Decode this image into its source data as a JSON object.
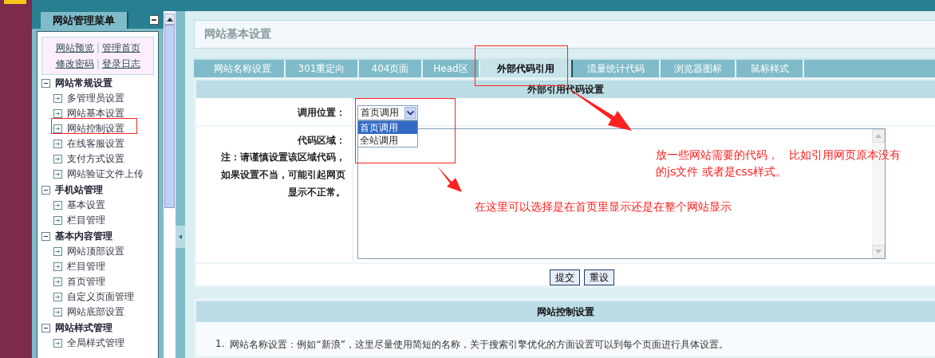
{
  "sidebar": {
    "title": "网站管理菜单",
    "quick_links": [
      "网站预览",
      "管理首页",
      "修改密码",
      "登录日志"
    ],
    "groups": [
      {
        "label": "网站常规设置",
        "expanded": true,
        "children": [
          {
            "label": "多管理员设置"
          },
          {
            "label": "网站基本设置"
          },
          {
            "label": "网站控制设置"
          },
          {
            "label": "在线客服设置"
          },
          {
            "label": "支付方式设置"
          },
          {
            "label": "网站验证文件上传"
          }
        ]
      },
      {
        "label": "手机站管理",
        "expanded": true,
        "children": [
          {
            "label": "基本设置"
          },
          {
            "label": "栏目管理"
          }
        ]
      },
      {
        "label": "基本内容管理",
        "expanded": true,
        "children": [
          {
            "label": "网站顶部设置"
          },
          {
            "label": "栏目管理"
          },
          {
            "label": "首页管理"
          },
          {
            "label": "自定义页面管理"
          },
          {
            "label": "网站底部设置"
          }
        ]
      },
      {
        "label": "网站样式管理",
        "expanded": true,
        "children": [
          {
            "label": "全局样式管理"
          }
        ]
      }
    ]
  },
  "page_title": "网站基本设置",
  "tabs": [
    {
      "label": "网站名称设置",
      "selected": false
    },
    {
      "label": "301重定向",
      "selected": false
    },
    {
      "label": "404页面",
      "selected": false
    },
    {
      "label": "Head区",
      "selected": false
    },
    {
      "label": "外部代码引用",
      "selected": true
    },
    {
      "label": "流量统计代码",
      "selected": false
    },
    {
      "label": "浏览器图标",
      "selected": false
    },
    {
      "label": "鼠标样式",
      "selected": false
    }
  ],
  "form": {
    "title": "外部引用代码设置",
    "fields": [
      {
        "kind": "select",
        "label": "调用位置：",
        "value": "首页调用",
        "expanded": true,
        "options": [
          {
            "label": "首页调用",
            "selected": true
          },
          {
            "label": "全站调用",
            "selected": false
          }
        ]
      },
      {
        "kind": "textarea",
        "label": "代码区域：",
        "note": "注：请谨慎设置该区域代码，如果设置不当，可能引起网页显示不正常。"
      }
    ],
    "buttons": [
      "提交",
      "重设"
    ]
  },
  "help": {
    "title": "网站控制设置",
    "items": [
      {
        "number": "1.",
        "text": "网站名称设置：例如“新浪”，这里尽量使用简短的名称，关于搜索引擎优化的方面设置可以到每个页面进行具体设置。"
      }
    ]
  },
  "annotations": [
    {
      "kind": "text",
      "text": "放一些网站需要的代码，   比如引用网页原本没有的js文件 或者是css样式。"
    },
    {
      "kind": "text",
      "text": "在这里可以选择是在首页里显示还是在整个网站显示"
    }
  ]
}
